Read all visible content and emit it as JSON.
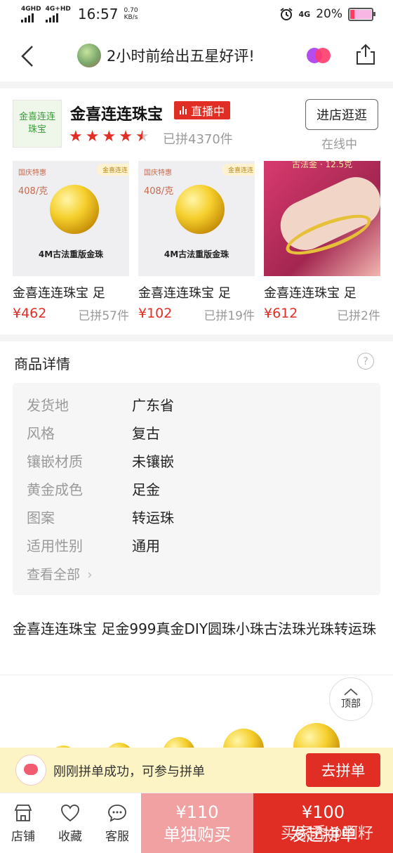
{
  "status_bar": {
    "network_1": "4GHD",
    "network_2": "4G+HD",
    "time": "16:57",
    "speed_value": "0.70",
    "speed_unit": "KB/s",
    "network_3": "4G",
    "battery_percent": "20%",
    "battery_level": 0.2
  },
  "nav": {
    "title": "2小时前给出五星好评!"
  },
  "store": {
    "logo_text": "金喜连连珠宝",
    "name": "金喜连连珠宝",
    "live_label": "直播中",
    "rating": 4.5,
    "sold_total": "已拼4370件",
    "visit_button": "进店逛逛",
    "online_status": "在线中"
  },
  "products": [
    {
      "name": "金喜连连珠宝  足",
      "price": "¥462",
      "sold": "已拼57件",
      "tag_left": "国庆特惠",
      "tag_right": "金喜连连",
      "per_gram": "408/克",
      "caption": "4M古法重版金珠"
    },
    {
      "name": "金喜连连珠宝  足",
      "price": "¥102",
      "sold": "已拼19件",
      "tag_left": "国庆特惠",
      "tag_right": "金喜连连",
      "per_gram": "408/克",
      "caption": "4M古法重版金珠"
    },
    {
      "name": "金喜连连珠宝  足",
      "price": "¥612",
      "sold": "已拼2件",
      "overlay_text": "古法金 · 12.5克"
    }
  ],
  "details": {
    "section_title": "商品详情",
    "specs": [
      {
        "key": "发货地",
        "value": "广东省"
      },
      {
        "key": "风格",
        "value": "复古"
      },
      {
        "key": "镶嵌材质",
        "value": "未镶嵌"
      },
      {
        "key": "黄金成色",
        "value": "足金"
      },
      {
        "key": "图案",
        "value": "转运珠"
      },
      {
        "key": "适用性别",
        "value": "通用"
      }
    ],
    "see_all": "查看全部",
    "full_title": "金喜连连珠宝 足金999真金DIY圆珠小珠古法珠光珠转运珠"
  },
  "top_button": "顶部",
  "notification": {
    "message": "刚刚拼单成功，可参与拼单",
    "action": "去拼单"
  },
  "bottom_bar": {
    "store": "店铺",
    "favorite": "收藏",
    "service": "客服",
    "single_price": "¥110",
    "single_label": "单独购买",
    "group_price": "¥100",
    "group_label": "发起拼单",
    "watermark": "买家秀@啊籽"
  },
  "colors": {
    "accent_red": "#e02e24",
    "light_red": "#f1a1a1",
    "notify_bg": "#fdf4c5"
  }
}
